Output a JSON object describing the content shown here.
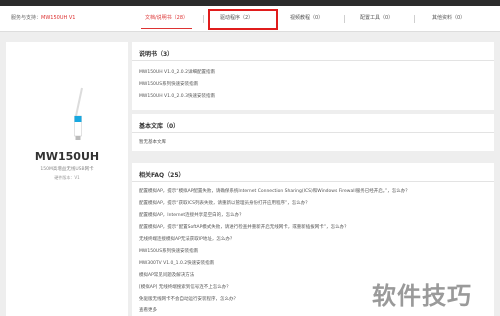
{
  "breadcrumb": {
    "prefix": "服务与支持：",
    "model": "MW150UH V1"
  },
  "tabs": [
    {
      "label": "文档/说明书（28）",
      "active": true
    },
    {
      "label": "驱动程序（2）",
      "active": false
    },
    {
      "label": "视频教程（0）",
      "active": false
    },
    {
      "label": "配置工具（0）",
      "active": false
    },
    {
      "label": "其他资料（0）",
      "active": false
    }
  ],
  "product": {
    "name": "MW150UH",
    "description": "150M高增益无线USB网卡",
    "version": "硬件版本：V1"
  },
  "manual": {
    "title": "说明书（3）",
    "items": [
      "MW150UH V1.0_2.0.2详细配置指南",
      "MW150US系列快速安装指南",
      "MW150UH V1.0_2.0.3快速安装指南"
    ]
  },
  "basic_docs": {
    "title": "基本文库（0）",
    "empty_text": "暂无基本文库"
  },
  "faq": {
    "title": "相关FAQ（25）",
    "items": [
      "配置模拟AP，提示“模拟AP配置失败，请确保系统Internet Connection Sharing(ICS)和Windows Firewall服务已经开启。”，怎么办？",
      "配置模拟AP，提示“获取ICS列表失败，请重新以管理员身份打开应用程序”，怎么办？",
      "配置模拟AP，Internet连接共享是空白的，怎么办？",
      "配置模拟AP，提示“配置SoftAP模式失败，请进行检查并重新开启无线网卡，或重新插拔网卡”，怎么办？",
      "无线终端连接模拟AP无法获取IP地址，怎么办？",
      "MW150US系列快速安装指南",
      "MW300TV V1.0_1.0.2快速安装指南",
      "模拟AP常见问题及解决方法",
      "[模拟AP] 无线终端搜索到信号连不上怎么办？",
      "免驱版无线网卡不会自动运行安装程序，怎么办？"
    ],
    "more": "查看更多"
  },
  "watermark": "软件技巧",
  "colors": {
    "accent": "#d33333",
    "highlight_box": "#e01c1c",
    "product_led": "#18a8e0"
  }
}
